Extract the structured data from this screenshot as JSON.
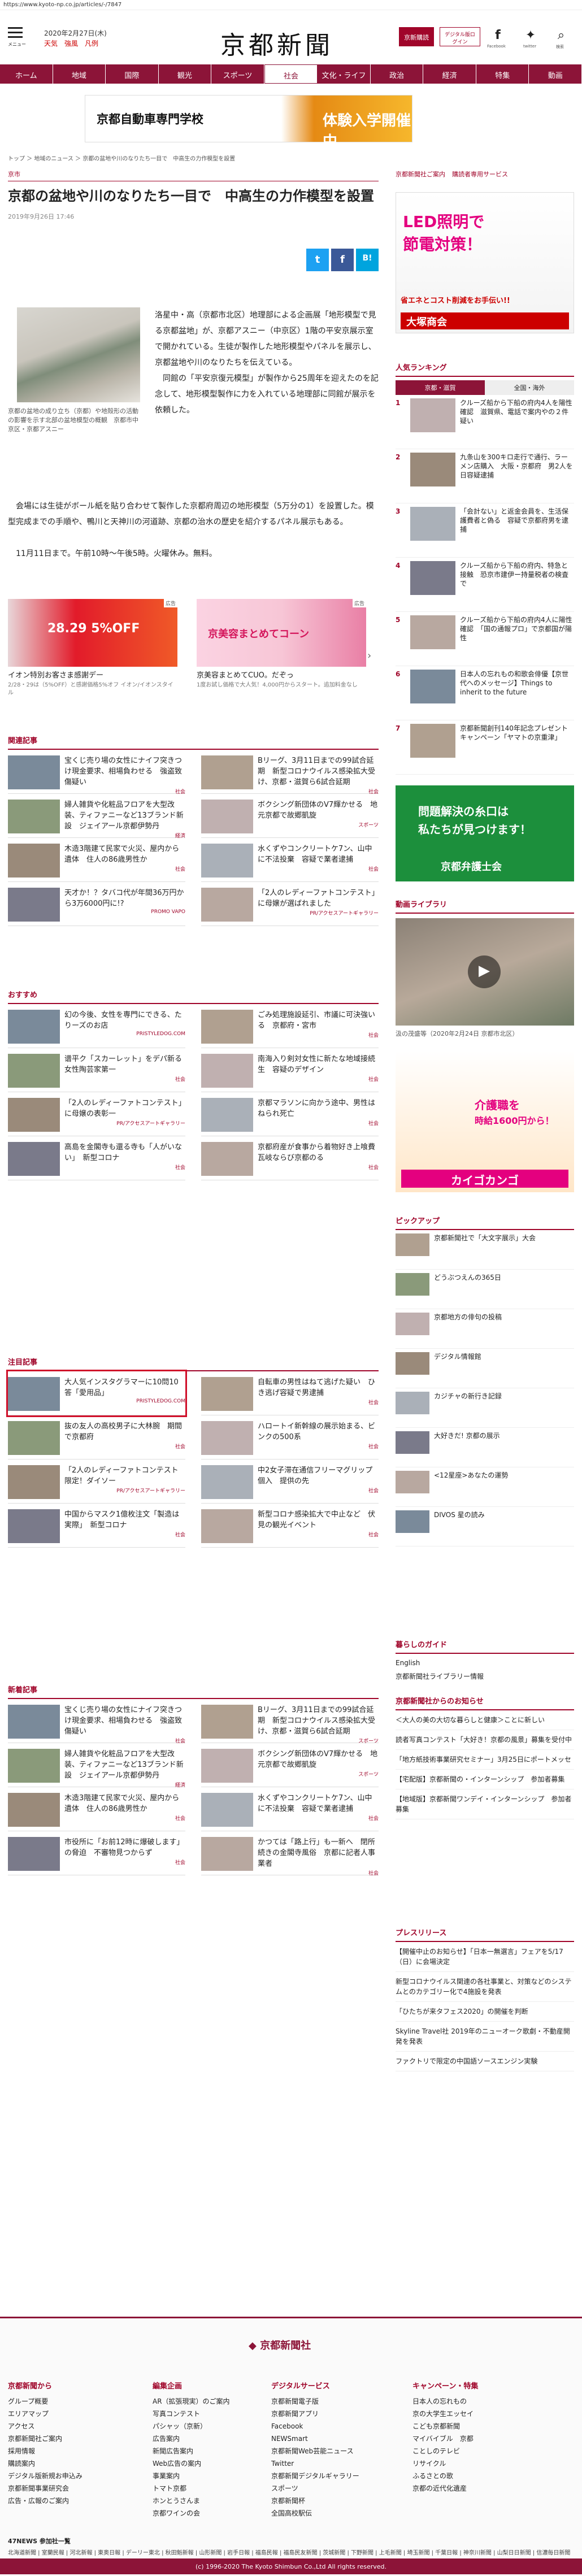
{
  "url": "https://www.kyoto-np.co.jp/articles/-/7847",
  "header": {
    "menu_label": "メニュー",
    "date": "2020年2月27日(木)",
    "weather": "天気　強風　凡例",
    "logo": "京都新聞",
    "btn1": "京新購読",
    "btn2": "デジタル版ログイン",
    "social": [
      "Facebook",
      "twitter",
      "検索"
    ]
  },
  "nav": [
    "ホーム",
    "地域",
    "国際",
    "観光",
    "スポーツ",
    "社会",
    "文化・ライフ",
    "政治",
    "経済",
    "特集",
    "動画"
  ],
  "nav_active": "社会",
  "banner": {
    "left": "京都自動車専門学校",
    "right": "体験入学開催中"
  },
  "breadcrumb": "トップ ＞ 地域のニュース ＞ 京都の盆地や川のなりたち一目で　中高生の力作模型を設置",
  "article": {
    "category": "京市",
    "title": "京都の盆地や川のなりたち一目で　中高生の力作模型を設置",
    "date": "2019年9月26日 17:46",
    "share": [
      "t",
      "f",
      "B!"
    ],
    "caption": "京都の盆地の成り立ち（京都）や地殻形の活動の影響を示す北部の盆地模型の概観　京都市中京区・京都アスニー",
    "body1": "洛星中・高（京都市北区）地理部による企画展「地形模型で見る京都盆地」が、京都アスニー（中京区）1階の平安京展示室で開かれている。生徒が製作した地形模型やパネルを展示し、京都盆地や川のなりたちを伝えている。\n　同館の「平安京復元模型」が製作から25周年を迎えたのを記念して、地形模型製作に力を入れている地理部に同館が展示を依頼した。",
    "body2": "　会場には生徒がボール紙を貼り合わせて製作した京都府周辺の地形模型（5万分の1）を設置した。模型完成までの手順や、鴨川と天神川の河道跡、京都の治水の歴史を紹介するパネル展示もある。\n\n　11月11日まで。午前10時〜午後5時。火曜休み。無料。"
  },
  "ads": [
    {
      "label": "広告",
      "title": "イオン特別お客さま感謝デー",
      "sub": "2/28・29は（5%OFF）と感謝価格5%オフ イオン/イオンスタイル",
      "img": "28.29 5%OFF"
    },
    {
      "label": "広告",
      "title": "京美容まとめてCUO。だぞっ",
      "sub": "1度お試し価格で大人気！4,000円からスタート。追加料金なし",
      "img": "京美容まとめてコーン"
    }
  ],
  "related": {
    "title": "関連記事",
    "items": [
      {
        "t": "宝くじ売り場の女性にナイフ突きつけ現金要求、相場負わせる　強盗致傷疑い",
        "s": "社会"
      },
      {
        "t": "Bリーグ、3月11日までの99試合延期　新型コロナウイルス感染拡大受け、京都・滋賀ら6試合延期",
        "s": "社会"
      },
      {
        "t": "婦人雑貨や化粧品フロアを大型改装、ティファニーなど13ブランド新設　ジェイアール京都伊勢丹",
        "s": "経済"
      },
      {
        "t": "ボクシング新団体のV7輝かせる　地元京都で故郷凱旋",
        "s": "スポーツ"
      },
      {
        "t": "木造3階建て民家で火災、屋内から遺体　住人の86歳男性か",
        "s": "社会"
      },
      {
        "t": "水くずやコンクリートケ7ン、山中に不法投棄　容疑で業者逮捕",
        "s": "社会"
      },
      {
        "t": "天才か！？タバコ代が年間36万円から3万6000円に!?",
        "s": "PROMO VAPO"
      },
      {
        "t": "「2人のレディーファトコンテスト」に母嬢が選ばれました",
        "s": "PR/アクセスアートギャラリー"
      }
    ]
  },
  "osusume": {
    "title": "おすすめ",
    "items": [
      {
        "t": "幻の今後、女性を専門にできる、たりーズのお店",
        "s": "PRISTYLEDOG.COM"
      },
      {
        "t": "ごみ処理施設延引、市議に可決強いる　京都府・宮市",
        "s": "社会"
      },
      {
        "t": "谱平ク「スカーレット」をデパ新る　女性陶芸家第一",
        "s": "社会"
      },
      {
        "t": "南海入り剣対女性に新たな地域接続生　容疑のデザイン",
        "s": "社会"
      },
      {
        "t": "「2人のレディーファトコンテスト」に母嬢の表彰一",
        "s": "PR/アクセスアートギャラリー"
      },
      {
        "t": "京都マラソンに向かう途中、男性はねられ死亡",
        "s": "社会"
      },
      {
        "t": "高島を金閣寺も還る寺も「人がいない」　新型コロナ",
        "s": "社会"
      },
      {
        "t": "京都府産が食事から着物好き上喰費　瓦岐ならび京都のる",
        "s": "社会"
      }
    ]
  },
  "attention": {
    "title": "注目記事",
    "items": [
      {
        "t": "大人気インスタグラマーに10問10答「愛用品」",
        "s": "PRISTYLEDOG.COM",
        "highlight": true
      },
      {
        "t": "自転車の男性はねて逃げた疑い　ひき逃げ容疑で男逮捕",
        "s": "社会"
      },
      {
        "t": "抜の友人の高校男子に大林腕　期間で京都府",
        "s": "社会"
      },
      {
        "t": "ハロートイ新幹線の展示始まる、ビンクの500系",
        "s": "社会"
      },
      {
        "t": "「2人のレディーファトコンテスト限定！ダイソー",
        "s": "PR/アクセスアートギャラリー"
      },
      {
        "t": "中2女子滞在通信フリーマグリップ個入　提供の先",
        "s": "社会"
      },
      {
        "t": "中国からマスク1億枚注文「製造は実際」　新型コロナ",
        "s": "社会"
      },
      {
        "t": "新型コロナ感染拡大で中止など　伏見の観光イベント",
        "s": "社会"
      }
    ]
  },
  "newest": {
    "title": "新着記事",
    "items": [
      {
        "t": "宝くじ売り場の女性にナイフ突きつけ現金要求、相場負わせる　強盗致傷疑い",
        "s": "社会"
      },
      {
        "t": "Bリーグ、3月11日までの99試合延期　新型コロナウイルス感染拡大受け、京都・滋賀ら6試合延期",
        "s": "スポーツ"
      },
      {
        "t": "婦人雑貨や化粧品フロアを大型改装、ティファニーなど13ブランド新設　ジェイアール京都伊勢丹",
        "s": "経済"
      },
      {
        "t": "ボクシング新団体のV7輝かせる　地元京都で故郷凱旋",
        "s": "スポーツ"
      },
      {
        "t": "木造3階建て民家で火災、屋内から遺体　住人の86歳男性か",
        "s": "社会"
      },
      {
        "t": "水くずやコンクリートケ7ン、山中に不法投棄　容疑で業者逮捕",
        "s": "社会"
      },
      {
        "t": "市役所に「お前12時に爆破します」の脅迫　不審物見つからず",
        "s": "社会"
      },
      {
        "t": "かつては「路上行」も一新へ　閉所続きの金閣寺風俗　京都に記者人事業者",
        "s": "社会"
      }
    ]
  },
  "side": {
    "tabs": [
      "京都新聞社ご案内",
      "購読者専用サービス"
    ],
    "ad_top": {
      "line1": "LED照明で",
      "line2": "節電対策！",
      "line3": "省エネとコスト削減をお手伝い!!",
      "line4": "大塚商会"
    },
    "ranking": {
      "title": "人気ランキング",
      "tabs": [
        "京都・滋賀",
        "全国・海外"
      ],
      "items": [
        "クルーズ船から下船の府内4人を陽性確認　滋賀県、電話で案内やの２件疑い",
        "九条山を300キロ走行で通行、ラーメン店購入　大阪・京都府　男2人を日容疑逮捕",
        "「会計ない」と返金会員を、生活保護費者と偽る　容疑で京都府男を逮捕",
        "クルーズ船から下船の府内、特急と接触　恐京市建伊ー持量税者の検査で",
        "クルーズ船から下船の府内4人に陽性確認　「国の通報プロ」で京都国が陽性",
        "日本人の忘れもの和歌会俳優【京世代へのメッセージ】Things to inherit to the future",
        "京都新聞創刊140年記念プレゼントキャンペーン「ヤマトの京重津」"
      ]
    },
    "ad2": {
      "line1": "問題解決の糸口は",
      "line2": "私たちが見つけます！",
      "line3": "京都弁護士会"
    },
    "video": {
      "title": "動画ライブラリ",
      "caption": "汲の茂盛等（2020年2月24日 京都市北区）"
    },
    "ad3": {
      "line1": "介護職を",
      "line2": "時給1600円から！",
      "line3": "カイゴカンゴ"
    },
    "pickup": {
      "title": "ピックアップ",
      "items": [
        "京都新聞社で「大文字展示」大会",
        "どうぶつえんの365日",
        "京都地方の俳句の投稿",
        "デジタル情報館",
        "カジチャの新行き記録",
        "大好きだ! 京都の展示",
        "<12星座>あなたの運勢",
        "DIVOS 星の読み"
      ]
    },
    "guide": {
      "title": "暮らしのガイド",
      "items": [
        "English",
        "京都新聞社ライブラリー情報"
      ]
    },
    "notice": {
      "title": "京都新聞社からのお知らせ",
      "items": [
        "＜大人の美の大切な暮らしと健康＞ことに新しい",
        "読者写真コンテスト「大好き！京都の風景」募集を受付中",
        "「地方紙技術事業研究セミナー」3月25日にポートメッセ",
        "【宅配版】京都新聞の・インターンシップ　参加者募集",
        "【地域版】京都新聞ワンデイ・インターンシップ　参加者募集"
      ]
    },
    "release": {
      "title": "プレスリリース",
      "items": [
        "【開催中止のお知らせ】「日本一無選言」フェアを5/17（日）に会場決定",
        "新型コロナウイルス関連の各社事業と、対策などのシステムとのカテゴリー化で4施設を発表",
        "「ひたちが来タフェス2020」の開催を判断",
        "Skyline Travel社 2019年のニューオーク歌劇・不動産開発を発表",
        "ファクトリで限定の中国語ソースエンジン実験"
      ]
    }
  },
  "footer": {
    "logo": "京都新聞社",
    "cols": [
      {
        "h": "京都新聞から",
        "items": [
          "グループ概要",
          "エリアマップ",
          "アクセス",
          "京都新聞社ご案内",
          "採用情報",
          "購読案内",
          "デジタル版新規お申込み",
          "京都新聞事業研究会",
          "広告・広報のご案内"
        ]
      },
      {
        "h": "編集企画",
        "items": [
          "AR（拡張現実）のご案内",
          "写真コンテスト",
          "パシャッ（京新）",
          "広告案内",
          "新聞広告案内",
          "Web広告の案内",
          "事業案内",
          "トマト京都",
          "ホンとうさんま",
          "京都ワインの会"
        ]
      },
      {
        "h": "デジタルサービス",
        "items": [
          "京都新聞電子版",
          "京都新聞アプリ",
          "Facebook",
          "NEWSmart",
          "京都新聞Web芸能ニュース",
          "Twitter",
          "京都新聞デジタルギャラリー",
          "スポーツ",
          "京都新聞杯",
          "全国高校駅伝"
        ]
      },
      {
        "h": "キャンペーン・特集",
        "items": [
          "日本人の忘れもの",
          "京の大学生エッセイ",
          "こども京都新聞",
          "マイバイブル　京都",
          "ことしのテレビ",
          "リサイクル",
          "ふるさとの歌",
          "京都の近代化遺産"
        ]
      }
    ],
    "news47_title": "47NEWS 参加社一覧",
    "news47": "北海道新聞 | 室蘭民報 | 河北新報 | 東奥日報 | デーリー東北 | 秋田魁新報 | 山形新聞 | 岩手日報 | 福島民報 | 福島民友新聞 | 茨城新聞 | 下野新聞 | 上毛新聞 | 埼玉新聞 | 千葉日報 | 神奈川新聞 | 山梨日日新聞 | 信濃毎日新聞 | 新潟日報 | 中日新聞 | 静岡新聞 | 岐阜新聞 | 北國新聞 | 福井新聞 | 京都新聞 | 神戸新聞 | 奈良新聞 | 山陰中央新報 | 山陽新聞 | 中国新聞 | 四国新聞 | 愛媛新聞 | 徳島新聞 | 高知新聞 | 西日本新聞 | 大分合同新聞 | 宮崎日日新聞 | 南日本新聞 | 沖縄タイムス | 琉球新報 | 共同通信",
    "copyright": "(c) 1996-2020 The Kyoto Shimbun Co.,Ltd All rights reserved."
  }
}
